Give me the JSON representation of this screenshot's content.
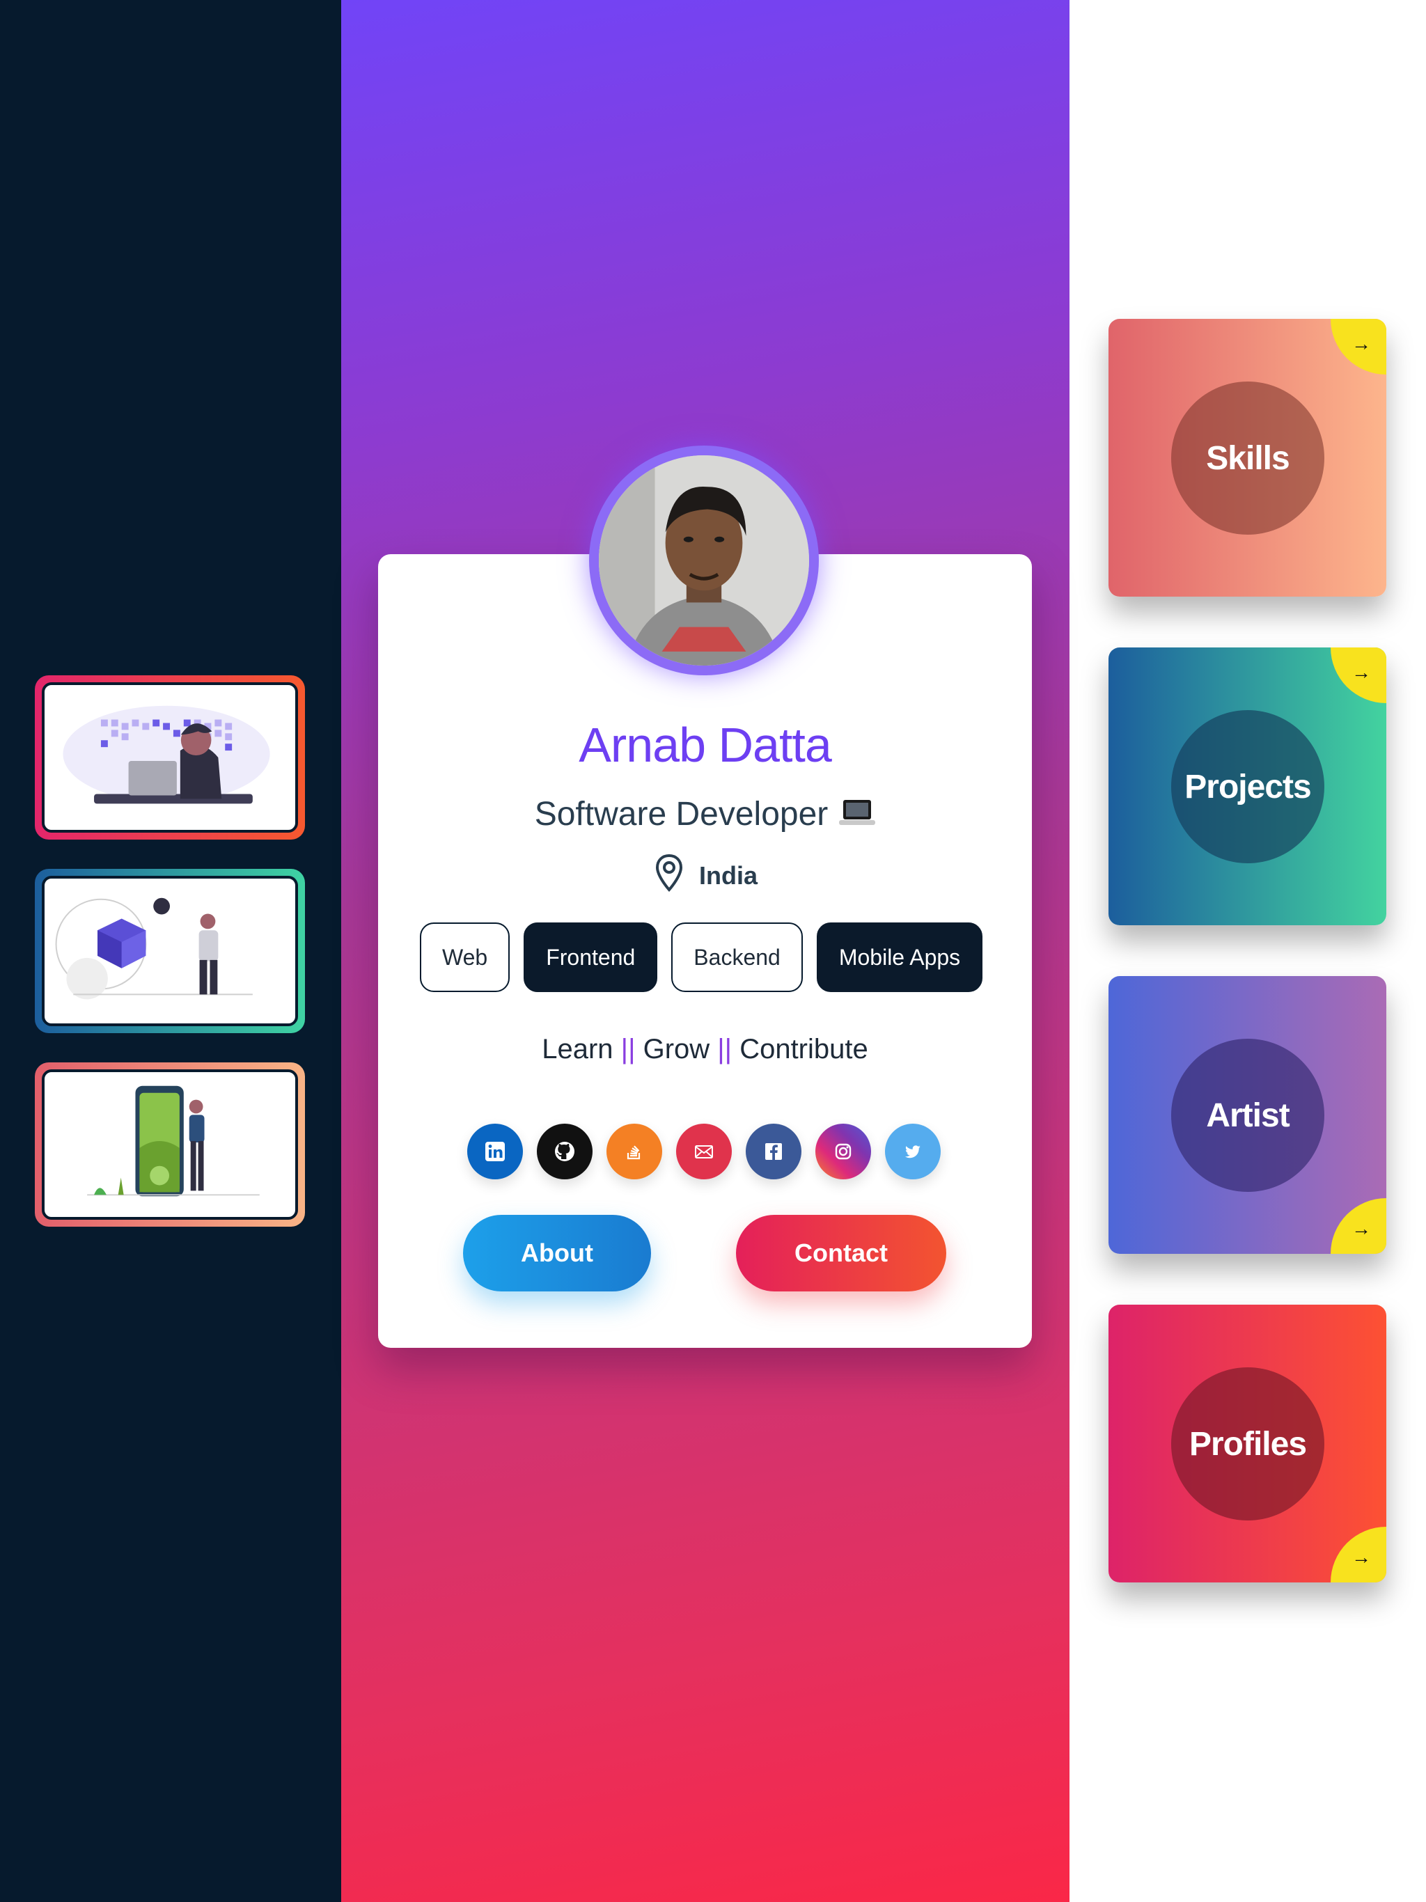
{
  "profile": {
    "name": "Arnab Datta",
    "role": "Software Developer",
    "location": "India"
  },
  "chips": [
    "Web",
    "Frontend",
    "Backend",
    "Mobile Apps"
  ],
  "tagline": {
    "part1": "Learn",
    "sep1": "||",
    "part2": "Grow",
    "sep2": "||",
    "part3": "Contribute"
  },
  "socials": [
    {
      "icon": "linkedin-icon",
      "color": "#0a66c2"
    },
    {
      "icon": "github-icon",
      "color": "#111111"
    },
    {
      "icon": "stackoverflow-icon",
      "color": "#f48024"
    },
    {
      "icon": "email-icon",
      "color": "#e0334c"
    },
    {
      "icon": "facebook-icon",
      "color": "#3b5998"
    },
    {
      "icon": "instagram-icon",
      "color": "#c13584"
    },
    {
      "icon": "twitter-icon",
      "color": "#55acee"
    }
  ],
  "buttons": {
    "about": "About",
    "contact": "Contact"
  },
  "features": [
    {
      "label": "Skills",
      "arrow": "→"
    },
    {
      "label": "Projects",
      "arrow": "→"
    },
    {
      "label": "Artist",
      "arrow": "→"
    },
    {
      "label": "Profiles",
      "arrow": "→"
    }
  ],
  "colors": {
    "accent": "#6d3ff2",
    "left_bg": "#061a2d",
    "arrow_badge": "#f8e21e"
  }
}
